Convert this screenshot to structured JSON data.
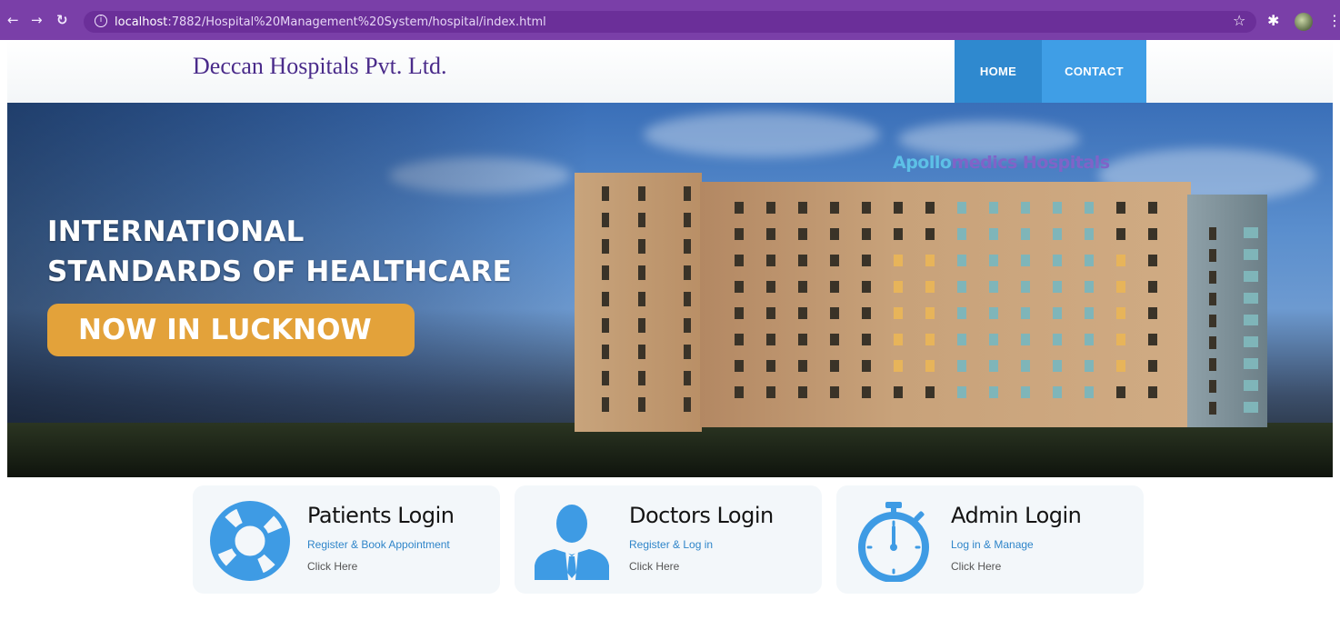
{
  "browser": {
    "url_host": "localhost",
    "url_rest": ":7882/Hospital%20Management%20System/hospital/index.html"
  },
  "site": {
    "brand": "Deccan Hospitals Pvt. Ltd.",
    "nav": [
      {
        "label": "HOME"
      },
      {
        "label": "CONTACT"
      }
    ]
  },
  "hero": {
    "line1": "INTERNATIONAL",
    "line2": "STANDARDS OF HEALTHCARE",
    "pill": "NOW IN LUCKNOW",
    "sign_brand": "Apollo",
    "sign_rest": "medics Hospitals"
  },
  "cards": [
    {
      "title": "Patients Login",
      "subtitle": "Register & Book Appointment",
      "link": "Click Here",
      "icon": "lifebuoy-icon"
    },
    {
      "title": "Doctors Login",
      "subtitle": "Register & Log in",
      "link": "Click Here",
      "icon": "doctor-icon"
    },
    {
      "title": "Admin Login",
      "subtitle": "Log in & Manage",
      "link": "Click Here",
      "icon": "stopwatch-icon"
    }
  ],
  "colors": {
    "browser_bar": "#7a3fa8",
    "nav_home": "#2f89cf",
    "nav_contact": "#3f9ee6",
    "brand": "#4a2b8a",
    "icon_blue": "#3e9be4",
    "pill": "#e3a23a"
  }
}
